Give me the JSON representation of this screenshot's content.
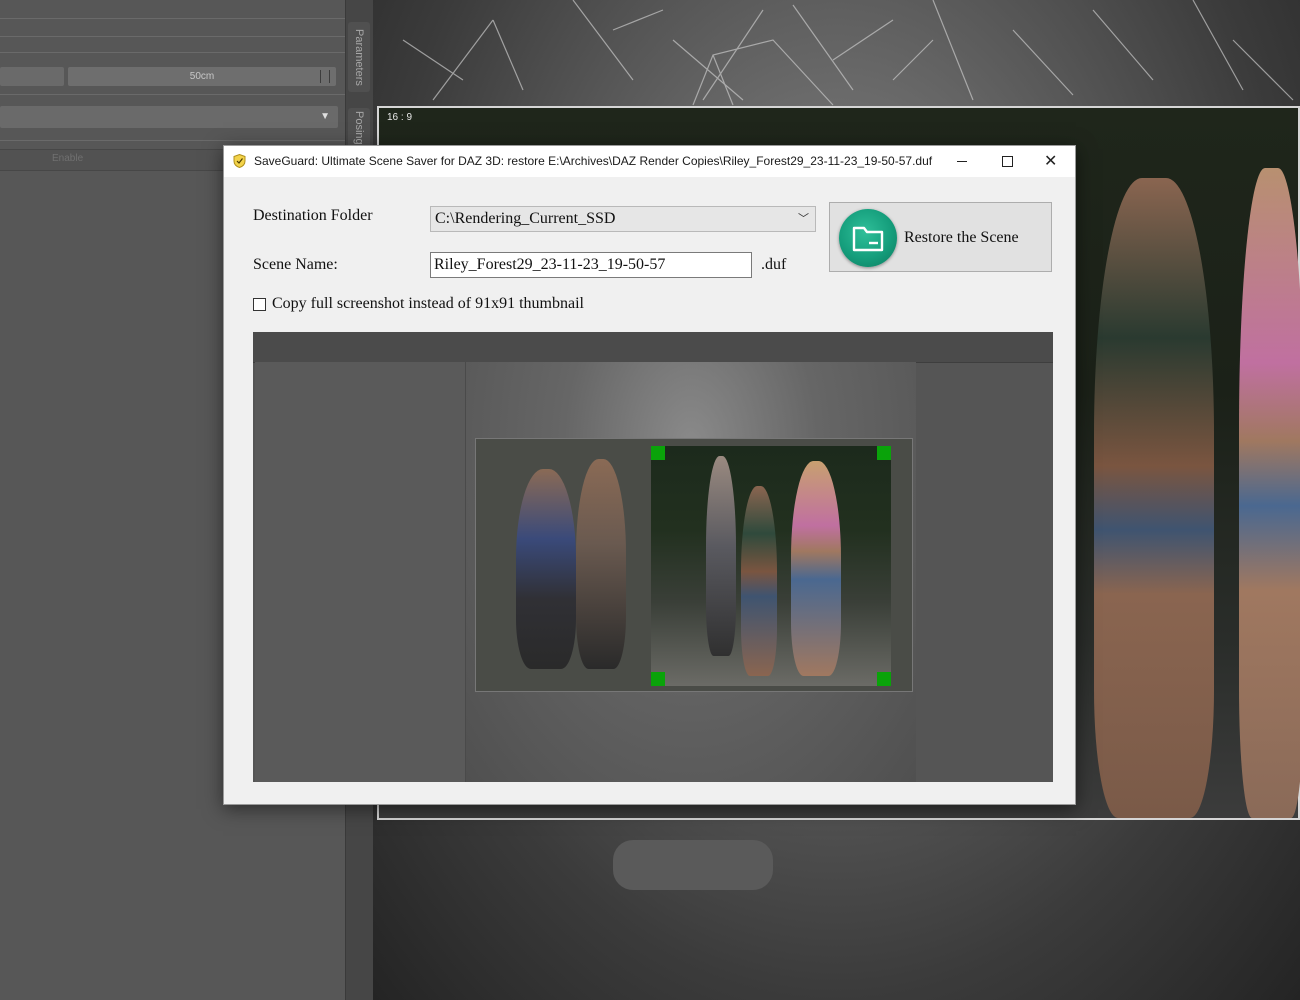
{
  "background_app": {
    "slider_value": "50cm",
    "enable_label": "Enable",
    "side_tabs": [
      "Parameters",
      "Posing"
    ],
    "viewport_ratio": "16 : 9"
  },
  "dialog": {
    "title": "SaveGuard: Ultimate Scene Saver for DAZ 3D: restore E:\\Archives\\DAZ Render Copies\\Riley_Forest29_23-11-23_19-50-57.duf",
    "window_controls": {
      "minimize": "minimize-icon",
      "maximize": "maximize-icon",
      "close": "close-icon"
    },
    "destination_label": "Destination Folder",
    "destination_value": "C:\\Rendering_Current_SSD",
    "scene_name_label": "Scene Name:",
    "scene_name_value": "Riley_Forest29_23-11-23_19-50-57",
    "extension": ".duf",
    "restore_button_label": "Restore the Scene",
    "restore_icon": "folder-icon",
    "checkbox_label": "Copy full screenshot instead of 91x91 thumbnail",
    "checkbox_checked": false
  },
  "colors": {
    "accent_teal": "#159e7c",
    "crop_marker_green": "#0aa30a"
  }
}
